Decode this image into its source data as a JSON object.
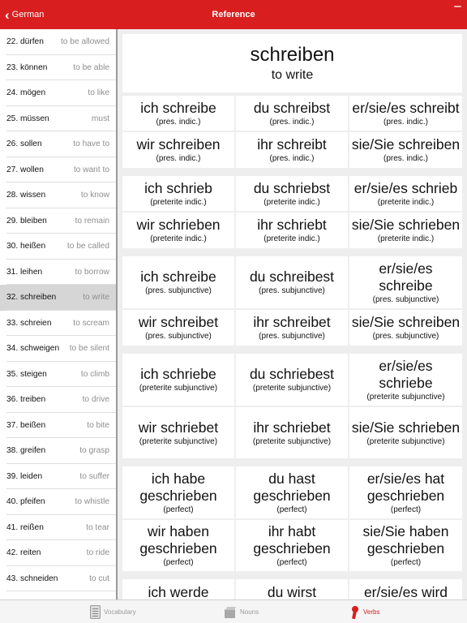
{
  "navbar": {
    "back_label": "German",
    "title": "Reference"
  },
  "sidebar": {
    "items": [
      {
        "label": "22. dürfen",
        "translation": "to be allowed"
      },
      {
        "label": "23. können",
        "translation": "to be able"
      },
      {
        "label": "24. mögen",
        "translation": "to like"
      },
      {
        "label": "25. müssen",
        "translation": "must"
      },
      {
        "label": "26. sollen",
        "translation": "to have to"
      },
      {
        "label": "27. wollen",
        "translation": "to want to"
      },
      {
        "label": "28. wissen",
        "translation": "to know"
      },
      {
        "label": "29. bleiben",
        "translation": "to remain"
      },
      {
        "label": "30. heißen",
        "translation": "to be called"
      },
      {
        "label": "31. leihen",
        "translation": "to borrow"
      },
      {
        "label": "32. schreiben",
        "translation": "to write",
        "selected": true
      },
      {
        "label": "33. schreien",
        "translation": "to scream"
      },
      {
        "label": "34. schweigen",
        "translation": "to be silent"
      },
      {
        "label": "35. steigen",
        "translation": "to climb"
      },
      {
        "label": "36. treiben",
        "translation": "to drive"
      },
      {
        "label": "37. beißen",
        "translation": "to bite"
      },
      {
        "label": "38. greifen",
        "translation": "to grasp"
      },
      {
        "label": "39. leiden",
        "translation": "to suffer"
      },
      {
        "label": "40. pfeifen",
        "translation": "to whistle"
      },
      {
        "label": "41. reißen",
        "translation": "to tear"
      },
      {
        "label": "42. reiten",
        "translation": "to ride"
      },
      {
        "label": "43. schneiden",
        "translation": "to cut"
      }
    ]
  },
  "verb": {
    "headword": "schreiben",
    "translation": "to write"
  },
  "conjugation_rows": [
    [
      {
        "form": "ich schreibe",
        "tense": "(pres. indic.)"
      },
      {
        "form": "du schreibst",
        "tense": "(pres. indic.)"
      },
      {
        "form": "er/sie/es schreibt",
        "tense": "(pres. indic.)"
      }
    ],
    [
      {
        "form": "wir schreiben",
        "tense": "(pres. indic.)"
      },
      {
        "form": "ihr schreibt",
        "tense": "(pres. indic.)"
      },
      {
        "form": "sie/Sie schreiben",
        "tense": "(pres. indic.)"
      }
    ],
    [
      {
        "form": "ich schrieb",
        "tense": "(preterite indic.)"
      },
      {
        "form": "du schriebst",
        "tense": "(preterite indic.)"
      },
      {
        "form": "er/sie/es schrieb",
        "tense": "(preterite indic.)"
      }
    ],
    [
      {
        "form": "wir schrieben",
        "tense": "(preterite indic.)"
      },
      {
        "form": "ihr schriebt",
        "tense": "(preterite indic.)"
      },
      {
        "form": "sie/Sie schrieben",
        "tense": "(preterite indic.)"
      }
    ],
    [
      {
        "form": "ich schreibe",
        "tense": "(pres. subjunctive)"
      },
      {
        "form": "du schreibest",
        "tense": "(pres. subjunctive)"
      },
      {
        "form": "er/sie/es schreibe",
        "tense": "(pres. subjunctive)"
      }
    ],
    [
      {
        "form": "wir schreibet",
        "tense": "(pres. subjunctive)"
      },
      {
        "form": "ihr schreibet",
        "tense": "(pres. subjunctive)"
      },
      {
        "form": "sie/Sie schreiben",
        "tense": "(pres. subjunctive)"
      }
    ],
    [
      {
        "form": "ich schriebe",
        "tense": "(preterite subjunctive)"
      },
      {
        "form": "du schriebest",
        "tense": "(preterite subjunctive)"
      },
      {
        "form": "er/sie/es schriebe",
        "tense": "(preterite subjunctive)"
      }
    ],
    [
      {
        "form": "wir schriebet",
        "tense": "(preterite subjunctive)"
      },
      {
        "form": "ihr schriebet",
        "tense": "(preterite subjunctive)"
      },
      {
        "form": "sie/Sie schrieben",
        "tense": "(preterite subjunctive)"
      }
    ],
    [
      {
        "form": "ich habe geschrieben",
        "tense": "(perfect)"
      },
      {
        "form": "du hast geschrieben",
        "tense": "(perfect)"
      },
      {
        "form": "er/sie/es hat geschrieben",
        "tense": "(perfect)"
      }
    ],
    [
      {
        "form": "wir haben geschrieben",
        "tense": "(perfect)"
      },
      {
        "form": "ihr habt geschrieben",
        "tense": "(perfect)"
      },
      {
        "form": "sie/Sie haben geschrieben",
        "tense": "(perfect)"
      }
    ],
    [
      {
        "form": "ich werde",
        "tense": ""
      },
      {
        "form": "du wirst",
        "tense": ""
      },
      {
        "form": "er/sie/es wird",
        "tense": ""
      }
    ]
  ],
  "tabbar": {
    "tabs": [
      {
        "label": "Vocabulary",
        "icon": "vocabulary-icon"
      },
      {
        "label": "Nouns",
        "icon": "nouns-icon"
      },
      {
        "label": "Verbs",
        "icon": "verbs-icon",
        "active": true
      }
    ]
  },
  "colors": {
    "accent": "#d81e1e",
    "selected_row": "#d6d6d6",
    "content_bg": "#eeeeee"
  }
}
